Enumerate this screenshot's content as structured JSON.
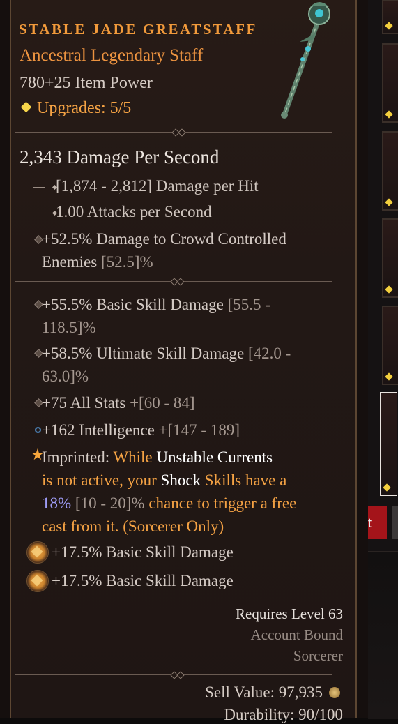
{
  "item": {
    "name": "STABLE JADE GREATSTAFF",
    "type": "Ancestral Legendary Staff",
    "item_power": "780+25 Item Power",
    "upgrades": "Upgrades: 5/5"
  },
  "weapon": {
    "dps": "2,343 Damage Per Second",
    "damage_per_hit": "[1,874 - 2,812] Damage per Hit",
    "attacks_per_second": "1.00 Attacks per Second",
    "implicit": {
      "line1": "+52.5% Damage to Crowd Controlled",
      "line2_text": "Enemies",
      "line2_range": "[52.5]%"
    }
  },
  "affixes": [
    {
      "line1_text": "+55.5% Basic Skill Damage",
      "line1_range": "[55.5 -",
      "line2_range": "118.5]%"
    },
    {
      "line1_text": "+58.5% Ultimate Skill Damage",
      "line1_range": "[42.0 -",
      "line2_range": "63.0]%"
    },
    {
      "text": "+75 All Stats",
      "range": "+[60 - 84]"
    },
    {
      "text": "+162 Intelligence",
      "range": "+[147 - 189]"
    }
  ],
  "imprint": {
    "label": "Imprinted:",
    "w1": "While",
    "w2": "Unstable Currents",
    "w3": "is not active, your",
    "w4": "Shock",
    "w5": "Skills have a",
    "w6": "18%",
    "w7": "[10 - 20]%",
    "w8": "chance to trigger a free",
    "w9": "cast from it. (Sorcerer Only)"
  },
  "sockets": [
    {
      "text": "+17.5% Basic Skill Damage"
    },
    {
      "text": "+17.5% Basic Skill Damage"
    }
  ],
  "requirements": {
    "level": "Requires Level 63",
    "bound": "Account Bound",
    "class": "Sorcerer"
  },
  "footer": {
    "sell_value": "Sell Value: 97,935",
    "durability": "Durability: 90/100"
  },
  "inventory": {
    "tab_char": "t"
  },
  "colors": {
    "legendary_orange": "#f4a244",
    "title_orange": "#f19a3b",
    "upgrade_gold": "#f7d54a",
    "roll_blue": "#9d9bf4",
    "stat_text": "#d4cac4",
    "panel_bg": "#221815"
  },
  "icons": [
    "upgrade-diamond-icon",
    "staff-item-icon",
    "affix-bullet-icon",
    "intelligence-icon",
    "imprint-star-icon",
    "socket-gem-icon",
    "gold-coin-icon"
  ]
}
